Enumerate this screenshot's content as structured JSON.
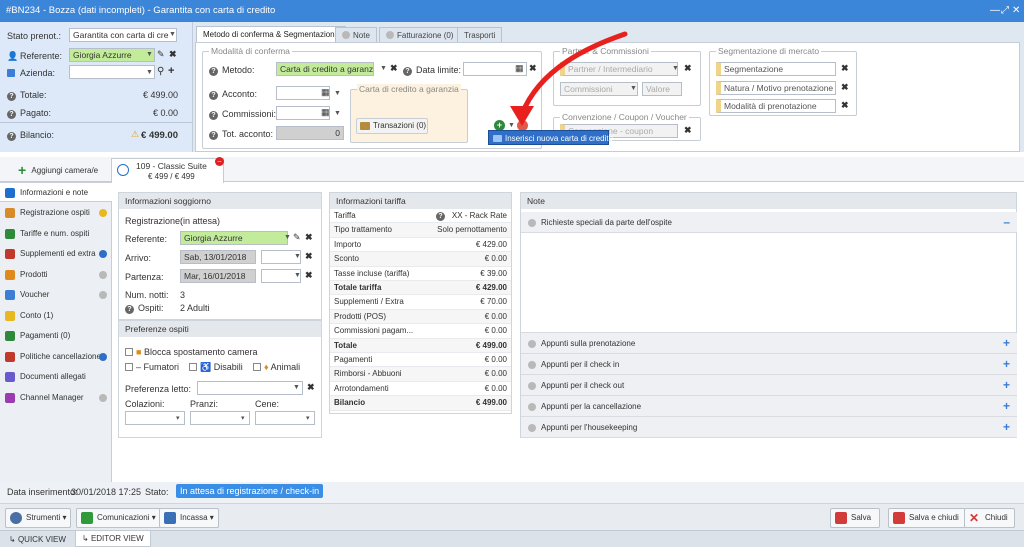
{
  "window": {
    "title": "#BN234 - Bozza (dati incompleti) - Garantita con carta di credito"
  },
  "left": {
    "stato_label": "Stato prenot.:",
    "stato_value": "Garantita con carta di cre",
    "referente_label": "Referente:",
    "referente_value": "Giorgia Azzurre",
    "azienda_label": "Azienda:",
    "totale_label": "Totale:",
    "totale_value": "€ 499.00",
    "pagato_label": "Pagato:",
    "pagato_value": "€ 0.00",
    "bilancio_label": "Bilancio:",
    "bilancio_value": "€ 499.00"
  },
  "tabs": [
    {
      "label": "Metodo di conferma & Segmentazione"
    },
    {
      "label": "Note"
    },
    {
      "label": "Fatturazione (0)"
    },
    {
      "label": "Trasporti"
    }
  ],
  "conferma": {
    "legend": "Modalità di conferma",
    "metodo_label": "Metodo:",
    "metodo_value": "Carta di credito a garanz",
    "data_limite_label": "Data limite:",
    "acconto_label": "Acconto:",
    "commissioni_label": "Commissioni:",
    "tot_acconto_label": "Tot. acconto:",
    "tot_acconto_value": "0",
    "cc_legend": "Carta di credito a garanzia",
    "transazioni_label": "Transazioni (0)",
    "tooltip": "Inserisci nuova carta di credito"
  },
  "partner": {
    "legend": "Partner & Commissioni",
    "partner_placeholder": "Partner / Intermediario",
    "commissioni_placeholder": "Commissioni",
    "valore_placeholder": "Valore",
    "convenzione_legend": "Convenzione / Coupon / Voucher",
    "convenzione_placeholder": "Convenzione - coupon"
  },
  "segmentazione": {
    "legend": "Segmentazione di mercato",
    "items": [
      "Segmentazione",
      "Natura / Motivo prenotazione",
      "Modalità di prenotazione"
    ]
  },
  "room_tabs": {
    "add_label": "Aggiungi camera/e",
    "room_title": "109 - Classic Suite",
    "room_price": "€ 499 / € 499"
  },
  "sidebar": {
    "items": [
      {
        "label": "Informazioni e note",
        "color": "#1f6fd0"
      },
      {
        "label": "Registrazione ospiti",
        "color": "#d98b2a"
      },
      {
        "label": "Tariffe e num. ospiti",
        "color": "#2e8a3a"
      },
      {
        "label": "Supplementi ed extra",
        "color": "#c0392b"
      },
      {
        "label": "Prodotti",
        "color": "#e08a1e"
      },
      {
        "label": "Voucher",
        "color": "#3a7ed6"
      },
      {
        "label": "Conto (1)",
        "color": "#e8b820"
      },
      {
        "label": "Pagamenti (0)",
        "color": "#2e8a3a"
      },
      {
        "label": "Politiche cancellazione",
        "color": "#c0392b"
      },
      {
        "label": "Documenti allegati",
        "color": "#6a5acd"
      },
      {
        "label": "Channel Manager",
        "color": "#9b3bb0"
      }
    ]
  },
  "soggiorno": {
    "header": "Informazioni soggiorno",
    "registrazione_label": "Registrazione:",
    "registrazione_value": "(in attesa)",
    "referente_label": "Referente:",
    "referente_value": "Giorgia Azzurre",
    "arrivo_label": "Arrivo:",
    "arrivo_value": "Sab, 13/01/2018",
    "partenza_label": "Partenza:",
    "partenza_value": "Mar, 16/01/2018",
    "notti_label": "Num. notti:",
    "notti_value": "3",
    "ospiti_label": "Ospiti:",
    "ospiti_value": "2 Adulti"
  },
  "preferenze": {
    "header": "Preferenze ospiti",
    "blocca": "Blocca spostamento camera",
    "fumatori": "Fumatori",
    "disabili": "Disabili",
    "animali": "Animali",
    "letto_label": "Preferenza letto:",
    "colazioni_label": "Colazioni:",
    "pranzi_label": "Pranzi:",
    "cene_label": "Cene:"
  },
  "tariffa": {
    "header": "Informazioni tariffa",
    "rows": [
      {
        "label": "Tariffa",
        "value": "XX - Rack Rate",
        "bold": false
      },
      {
        "label": "Tipo trattamento",
        "value": "Solo pernottamento",
        "bold": false
      },
      {
        "label": "Importo",
        "value": "€ 429.00",
        "bold": false
      },
      {
        "label": "Sconto",
        "value": "€ 0.00",
        "bold": false
      },
      {
        "label": "Tasse incluse (tariffa)",
        "value": "€ 39.00",
        "bold": false
      },
      {
        "label": "Totale tariffa",
        "value": "€ 429.00",
        "bold": true
      },
      {
        "label": "Supplementi / Extra",
        "value": "€ 70.00",
        "bold": false
      },
      {
        "label": "Prodotti (POS)",
        "value": "€ 0.00",
        "bold": false
      },
      {
        "label": "Commissioni pagam...",
        "value": "€ 0.00",
        "bold": false
      },
      {
        "label": "Totale",
        "value": "€ 499.00",
        "bold": true
      },
      {
        "label": "Pagamenti",
        "value": "€ 0.00",
        "bold": false
      },
      {
        "label": "Rimborsi - Abbuoni",
        "value": "€ 0.00",
        "bold": false
      },
      {
        "label": "Arrotondamenti",
        "value": "€ 0.00",
        "bold": false
      },
      {
        "label": "Bilancio",
        "value": "€ 499.00",
        "bold": true
      }
    ]
  },
  "note": {
    "header": "Note",
    "top": "Richieste speciali da parte dell'ospite",
    "items": [
      "Appunti sulla prenotazione",
      "Appunti per il check in",
      "Appunti per il check out",
      "Appunti per la cancellazione",
      "Appunti per l'housekeeping"
    ]
  },
  "status": {
    "data_label": "Data inserimento:",
    "data_value": "30/01/2018 17:25",
    "stato_label": "Stato:",
    "stato_value": "In attesa di registrazione / check-in"
  },
  "toolbar": {
    "strumenti": "Strumenti",
    "comunicazioni": "Comunicazioni",
    "incassa": "Incassa",
    "salva": "Salva",
    "salva_chiudi": "Salva e chiudi",
    "chiudi": "Chiudi"
  },
  "bottom_tabs": {
    "quick": "QUICK VIEW",
    "editor": "EDITOR VIEW"
  }
}
